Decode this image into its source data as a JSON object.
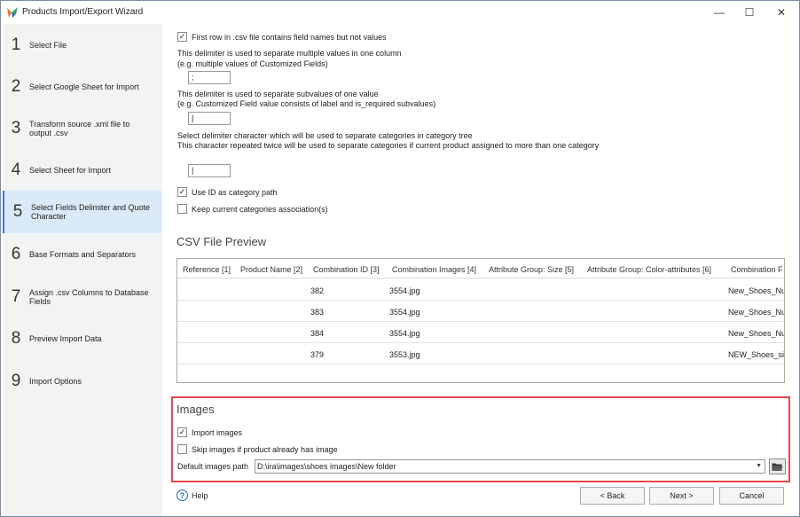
{
  "window": {
    "title": "Products Import/Export Wizard",
    "minimize": "—",
    "maximize": "☐",
    "close": "✕"
  },
  "steps": [
    {
      "num": "1",
      "label": "Select File"
    },
    {
      "num": "2",
      "label": "Select Google Sheet for Import"
    },
    {
      "num": "3",
      "label": "Transform source .xml file to output .csv"
    },
    {
      "num": "4",
      "label": "Select Sheet for Import"
    },
    {
      "num": "5",
      "label": "Select Fields Delimiter and Quote Character",
      "active": true
    },
    {
      "num": "6",
      "label": "Base Formats and Separators"
    },
    {
      "num": "7",
      "label": "Assign .csv Columns to Database Fields"
    },
    {
      "num": "8",
      "label": "Preview Import Data"
    },
    {
      "num": "9",
      "label": "Import Options"
    }
  ],
  "options": {
    "first_row_label": "First row in .csv file contains field names but not values",
    "first_row_checked": true,
    "multi_delim_line1": "This delimiter is used to separate multiple values in one column",
    "multi_delim_line2": "(e.g. multiple values of Customized Fields)",
    "multi_delim_value": ";",
    "subval_line1": "This delimiter is used to separate subvalues of one value",
    "subval_line2": "(e.g. Customized Field value consists of label and is_required subvalues)",
    "subval_value": "|",
    "cat_line1": "Select delimiter character which will be used to separate categories in category tree",
    "cat_line2": "This character repeated twice will be used to separate categories if current product assigned to more than one category",
    "cat_value": "|",
    "use_id_label": "Use ID as category path",
    "use_id_checked": true,
    "keep_assoc_label": "Keep current categories association(s)",
    "keep_assoc_checked": false
  },
  "preview": {
    "title": "CSV File Preview",
    "columns": [
      "Reference [1]",
      "Product Name [2]",
      "Combination ID [3]",
      "Combination Images [4]",
      "Attribute Group: Size [5]",
      "Attribute Group: Color-attributes [6]",
      "Combination F"
    ],
    "rows": [
      [
        "",
        "",
        "382",
        "3554.jpg",
        "",
        "",
        "New_Shoes_Nu"
      ],
      [
        "",
        "",
        "383",
        "3554.jpg",
        "",
        "",
        "New_Shoes_Nu"
      ],
      [
        "",
        "",
        "384",
        "3554.jpg",
        "",
        "",
        "New_Shoes_Nu"
      ],
      [
        "",
        "",
        "379",
        "3553.jpg",
        "",
        "",
        "NEW_Shoes_sil"
      ]
    ]
  },
  "images": {
    "title": "Images",
    "import_label": "Import images",
    "import_checked": true,
    "skip_label": "Skip images if product already has image",
    "skip_checked": false,
    "path_label": "Default images path",
    "path_value": "D:\\ira\\images\\shoes images\\New folder"
  },
  "footer": {
    "help": "Help",
    "back": "< Back",
    "next": "Next >",
    "cancel": "Cancel"
  },
  "colors": {
    "highlight_border": "#e84848",
    "active_step_bg": "#dbeaf9"
  }
}
